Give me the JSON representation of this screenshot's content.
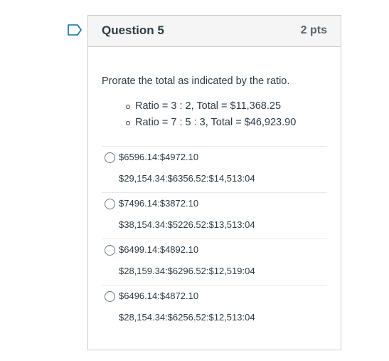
{
  "question": {
    "title": "Question 5",
    "points": "2 pts",
    "prompt": "Prorate the total as indicated by the ratio.",
    "ratios": [
      "Ratio = 3 : 2, Total = $11,368.25",
      "Ratio = 7 : 5 : 3, Total = $46,923.90"
    ],
    "answers": [
      {
        "line1": "$6596.14:$4972.10",
        "line2": "$29,154.34:$6356.52:$14,513:04"
      },
      {
        "line1": "$7496.14:$3872.10",
        "line2": "$38,154.34:$5226.52:$13,513:04"
      },
      {
        "line1": "$6499.14:$4892.10",
        "line2": "$28,159.34:$6296.52:$12,519:04"
      },
      {
        "line1": "$6496.14:$4872.10",
        "line2": "$28,154.34:$6256.52:$12,513:04"
      }
    ]
  },
  "icons": {
    "flag": "bookmark-flag-icon",
    "flag_color": "#0770a3"
  }
}
